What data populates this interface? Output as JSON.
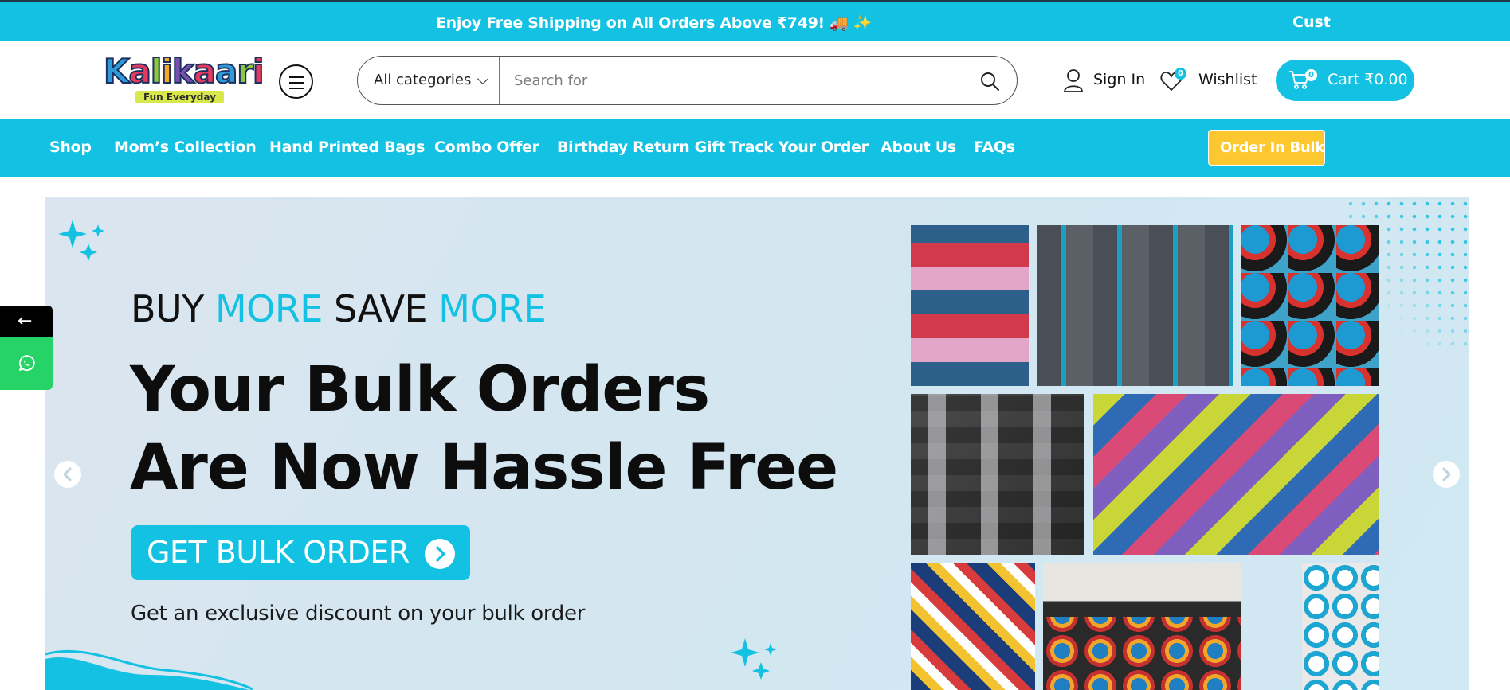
{
  "topbar": {
    "announcement": "Enjoy Free Shipping on All Orders Above ₹749! 🚚 ✨",
    "right_text": "Cust"
  },
  "header": {
    "logo_text": "Kalikaari",
    "logo_tagline": "Fun Everyday",
    "search": {
      "category": "All categories",
      "placeholder": "Search for"
    },
    "signin_label": "Sign In",
    "wishlist_label": "Wishlist",
    "wishlist_count": "0",
    "cart_label": "Cart ₹0.00",
    "cart_count": "0"
  },
  "nav": {
    "items": [
      {
        "label": "Shop"
      },
      {
        "label": "Mom’s Collection"
      },
      {
        "label": "Hand Printed Bags"
      },
      {
        "label": "Combo Offer"
      },
      {
        "label": "Birthday Return Gift"
      },
      {
        "label": "Track Your Order"
      },
      {
        "label": "About Us"
      },
      {
        "label": "FAQs"
      }
    ],
    "bulk_button": "Order In Bulk"
  },
  "hero": {
    "kicker_1": "BUY",
    "kicker_2": "MORE",
    "kicker_3": "SAVE",
    "kicker_4": "MORE",
    "headline_line1": "Your Bulk Orders",
    "headline_line2": "Are Now Hassle Free",
    "cta_label": "GET BULK ORDER",
    "subtext": "Get an exclusive discount on your bulk order"
  },
  "side_buttons": {
    "back_glyph": "←"
  },
  "colors": {
    "accent": "#13c1e2",
    "bulk_button": "#fcc72f",
    "whatsapp": "#25d366"
  }
}
